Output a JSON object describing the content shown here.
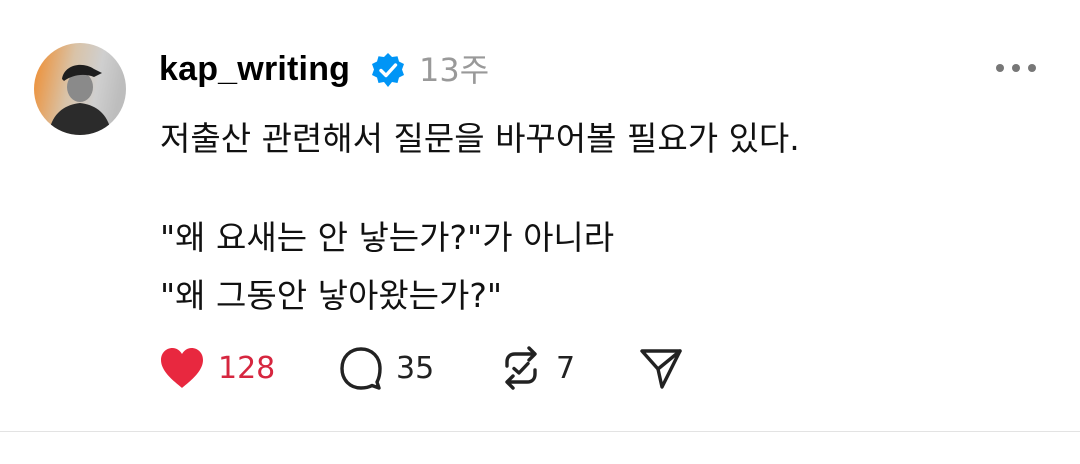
{
  "post": {
    "username": "kap_writing",
    "verified": true,
    "time": "13주",
    "text_lines": [
      "저출산 관련해서 질문을 바꾸어볼 필요가 있다.",
      "\"왜 요새는 안 낳는가?\"가 아니라",
      "\"왜 그동안 낳아왔는가?\""
    ]
  },
  "actions": {
    "likes": "128",
    "replies": "35",
    "reposts": "7"
  },
  "colors": {
    "like": "#e8283f",
    "verified": "#0095f6",
    "time": "#999999"
  }
}
